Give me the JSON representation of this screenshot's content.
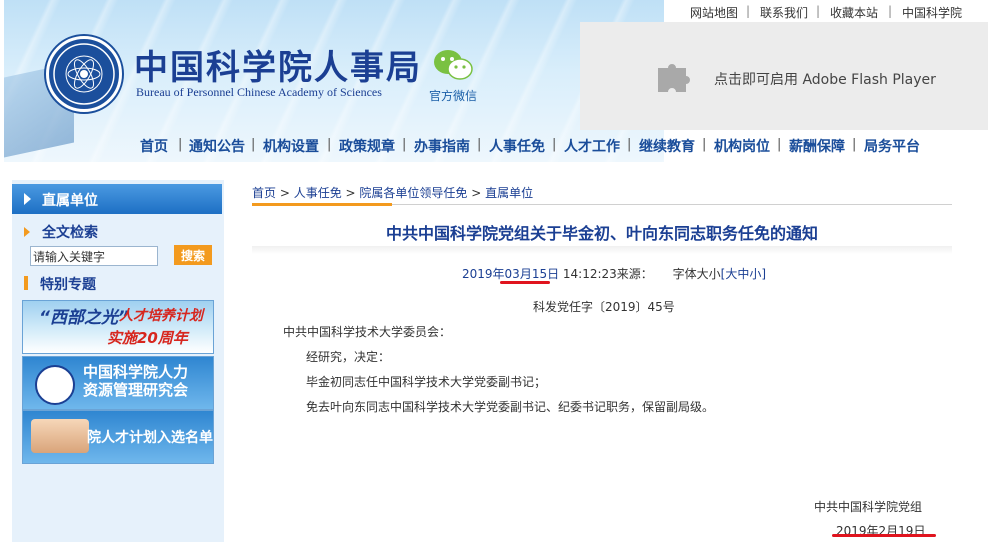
{
  "header": {
    "site_title": "中国科学院人事局",
    "site_subtitle": "Bureau of Personnel Chinese Academy of Sciences",
    "wechat_label": "官方微信",
    "top_links": [
      "网站地图",
      "联系我们",
      "收藏本站",
      "中国科学院"
    ],
    "flash_text": "点击即可启用 Adobe Flash Player"
  },
  "nav": [
    "首页",
    "通知公告",
    "机构设置",
    "政策规章",
    "办事指南",
    "人事任免",
    "人才工作",
    "继续教育",
    "机构岗位",
    "薪酬保障",
    "局务平台"
  ],
  "sidebar": {
    "heading": "直属单位",
    "search_title": "全文检索",
    "search_value": "请输入关键字",
    "search_button": "搜索",
    "special_title": "特别专题",
    "banner1": {
      "line1": "“西部之光”",
      "line2": "人才培养计划",
      "line3": "实施20周年"
    },
    "banner2": {
      "line1": "中国科学院人力",
      "line2": "资源管理研究会"
    },
    "banner3": "院人才计划入选名单"
  },
  "breadcrumb": [
    "首页",
    "人事任免",
    "院属各单位领导任免",
    "直属单位"
  ],
  "article": {
    "title": "中共中国科学院党组关于毕金初、叶向东同志职务任免的通知",
    "date_prefix": "2019年",
    "date_highlight": "03月15日",
    "time_source": " 14:12:23来源：",
    "font_size_label": "字体大小",
    "font_size_options": "[大中小]",
    "doc_number": "科发党任字〔2019〕45号",
    "addressee": "中共中国科学技术大学委员会：",
    "paragraphs": [
      "经研究，决定：",
      "毕金初同志任中国科学技术大学党委副书记；",
      "免去叶向东同志中国科学技术大学党委副书记、纪委书记职务，保留副局级。"
    ],
    "signature": "中共中国科学院党组",
    "sign_date": "2019年2月19日"
  },
  "colors": {
    "brand_blue": "#1b3f93",
    "accent_orange": "#f39a1e",
    "annotation_red": "#e0141e"
  }
}
